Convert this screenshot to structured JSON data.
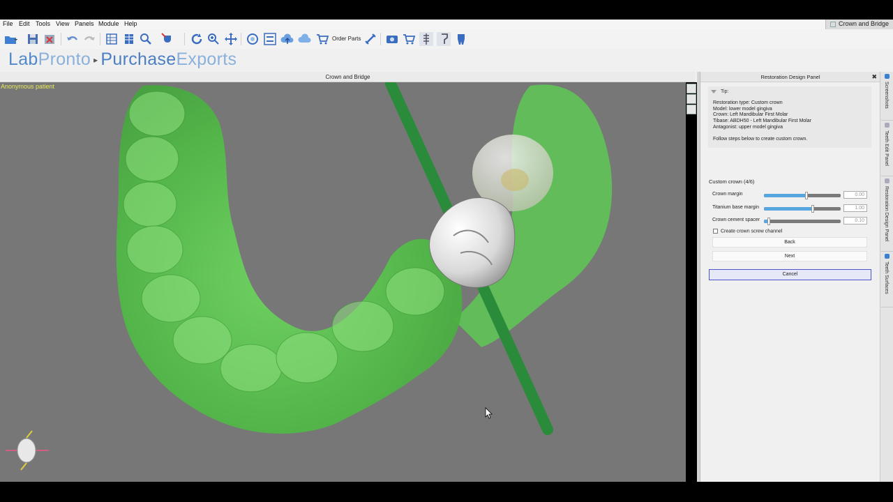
{
  "menu": [
    "File",
    "Edit",
    "Tools",
    "View",
    "Panels",
    "Module",
    "Help"
  ],
  "module_tab": "Crown and Bridge",
  "toolbar": {
    "order_parts_label": "Order Parts"
  },
  "brand": {
    "lab": "Lab",
    "pronto": "Pronto",
    "purchase": "Purchase",
    "exports": "Exports"
  },
  "viewport": {
    "title": "Crown and Bridge",
    "patient": "Anonymous patient"
  },
  "panel": {
    "title": "Restoration Design Panel",
    "tip_label": "Tip:",
    "tip_lines": [
      "Restoration type: Custom crown",
      "Model: lower model gingiva",
      "Crown: Left Mandibular First Molar",
      "Tibase: ABDH50 - Left Mandibular First Molar",
      "Antagonist: upper model gingiva"
    ],
    "tip_follow": "Follow steps below to create custom crown.",
    "section": "Custom crown (4/6)",
    "sliders": [
      {
        "label": "Crown margin",
        "value": "0.00",
        "level": 0.55
      },
      {
        "label": "Titanium base margin",
        "value": "1.00",
        "level": 0.64
      },
      {
        "label": "Crown cement spacer",
        "value": "0.10",
        "level": 0.06
      }
    ],
    "checkbox_label": "Create crown screw channel",
    "back_label": "Back",
    "next_label": "Next",
    "cancel_label": "Cancel"
  },
  "side_tabs": [
    "Screenshots",
    "Teeth Edit Panel",
    "Restoration Design Panel",
    "Teeth Surfaces"
  ],
  "colors": {
    "gingiva": "#5bc94f",
    "viewport_bg": "#777777",
    "accent": "#58a6df",
    "brand_blue": "#4c7fc2"
  }
}
